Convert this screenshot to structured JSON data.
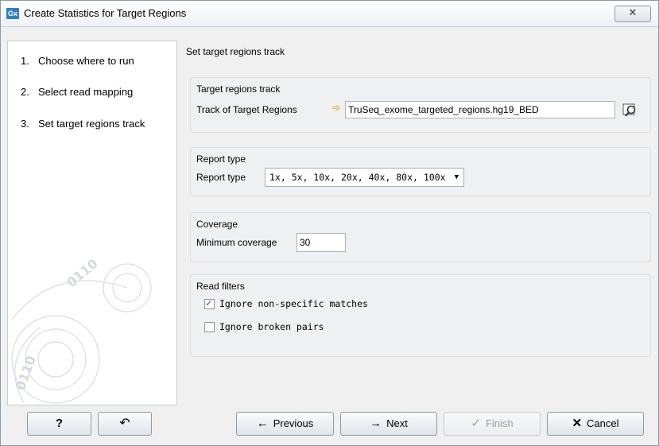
{
  "window": {
    "icon_text": "Gx",
    "title": "Create Statistics for Target Regions",
    "close_glyph": "✕"
  },
  "steps": [
    {
      "num": "1.",
      "label": "Choose where to run"
    },
    {
      "num": "2.",
      "label": "Select read mapping"
    },
    {
      "num": "3.",
      "label": "Set target regions track"
    }
  ],
  "panel_heading": "Set target regions track",
  "target_regions": {
    "group_title": "Target regions track",
    "label": "Track of Target Regions",
    "value": "TruSeq_exome_targeted_regions.hg19_BED",
    "browse_icon": "browse-icon"
  },
  "report_type": {
    "group_title": "Report type",
    "label": "Report type",
    "selected": "1x, 5x, 10x, 20x, 40x, 80x, 100x"
  },
  "coverage": {
    "group_title": "Coverage",
    "label": "Minimum coverage",
    "value": "30"
  },
  "read_filters": {
    "group_title": "Read filters",
    "options": [
      {
        "label": "Ignore non-specific matches",
        "checked": true
      },
      {
        "label": "Ignore broken pairs",
        "checked": false
      }
    ]
  },
  "buttons": {
    "help": "?",
    "reset": "↶",
    "previous": "Previous",
    "next": "Next",
    "finish": "Finish",
    "cancel": "Cancel",
    "previous_glyph": "←",
    "next_glyph": "→",
    "finish_glyph": "✓",
    "cancel_glyph": "✕"
  },
  "colors": {
    "accent": "#2f7fc6",
    "background": "#f0f0f0",
    "check": "#1b4f9c"
  }
}
